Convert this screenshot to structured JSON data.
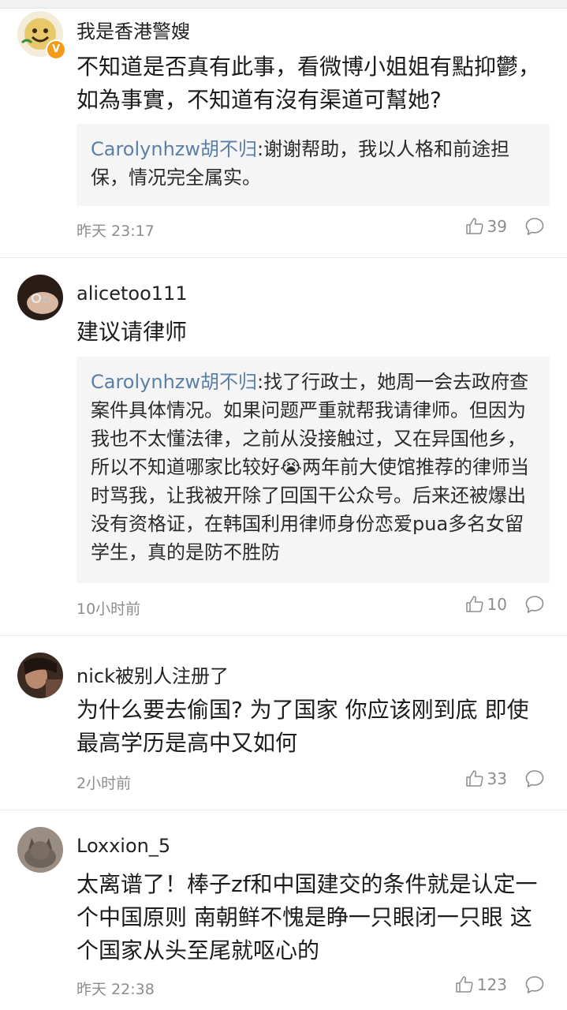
{
  "comments": [
    {
      "username": "我是香港警嫂",
      "avatar": "smiley-avatar",
      "verified_badge": "V",
      "text": "不知道是否真有此事，看微博小姐姐有點抑鬱，如為事實，不知道有沒有渠道可幫她?",
      "reply_user": "Carolynhzw胡不归",
      "reply_text": ":谢谢帮助，我以人格和前途担保，情况完全属实。",
      "time": "昨天 23:17",
      "likes": "39"
    },
    {
      "username": "alicetoo111",
      "avatar": "ring-hand-avatar",
      "text": "建议请律师",
      "reply_user": "Carolynhzw胡不归",
      "reply_text": ":找了行政士，她周一会去政府查案件具体情况。如果问题严重就帮我请律师。但因为我也不太懂法律，之前从没接触过，又在异国他乡，所以不知道哪家比较好😭两年前大使馆推荐的律师当时骂我，让我被开除了回国干公众号。后来还被爆出没有资格证，在韩国利用律师身份恋爱pua多名女留学生，真的是防不胜防",
      "time": "10小时前",
      "likes": "10"
    },
    {
      "username": "nick被别人注册了",
      "avatar": "photo-avatar",
      "text": "为什么要去偷国? 为了国家 你应该刚到底 即使最高学历是高中又如何",
      "time": "2小时前",
      "likes": "33"
    },
    {
      "username": "Loxxion_5",
      "avatar": "cat-avatar",
      "text": "太离谱了！棒子zf和中国建交的条件就是认定一个中国原则 南朝鲜不愧是睁一只眼闭一只眼 这个国家从头至尾就呕心的",
      "time": "昨天 22:38",
      "likes": "123"
    }
  ],
  "colors": {
    "reply_user": "#5b7fa6",
    "meta": "#8d8d8d",
    "reply_bg": "#f5f5f5",
    "badge": "#f59b1b"
  }
}
